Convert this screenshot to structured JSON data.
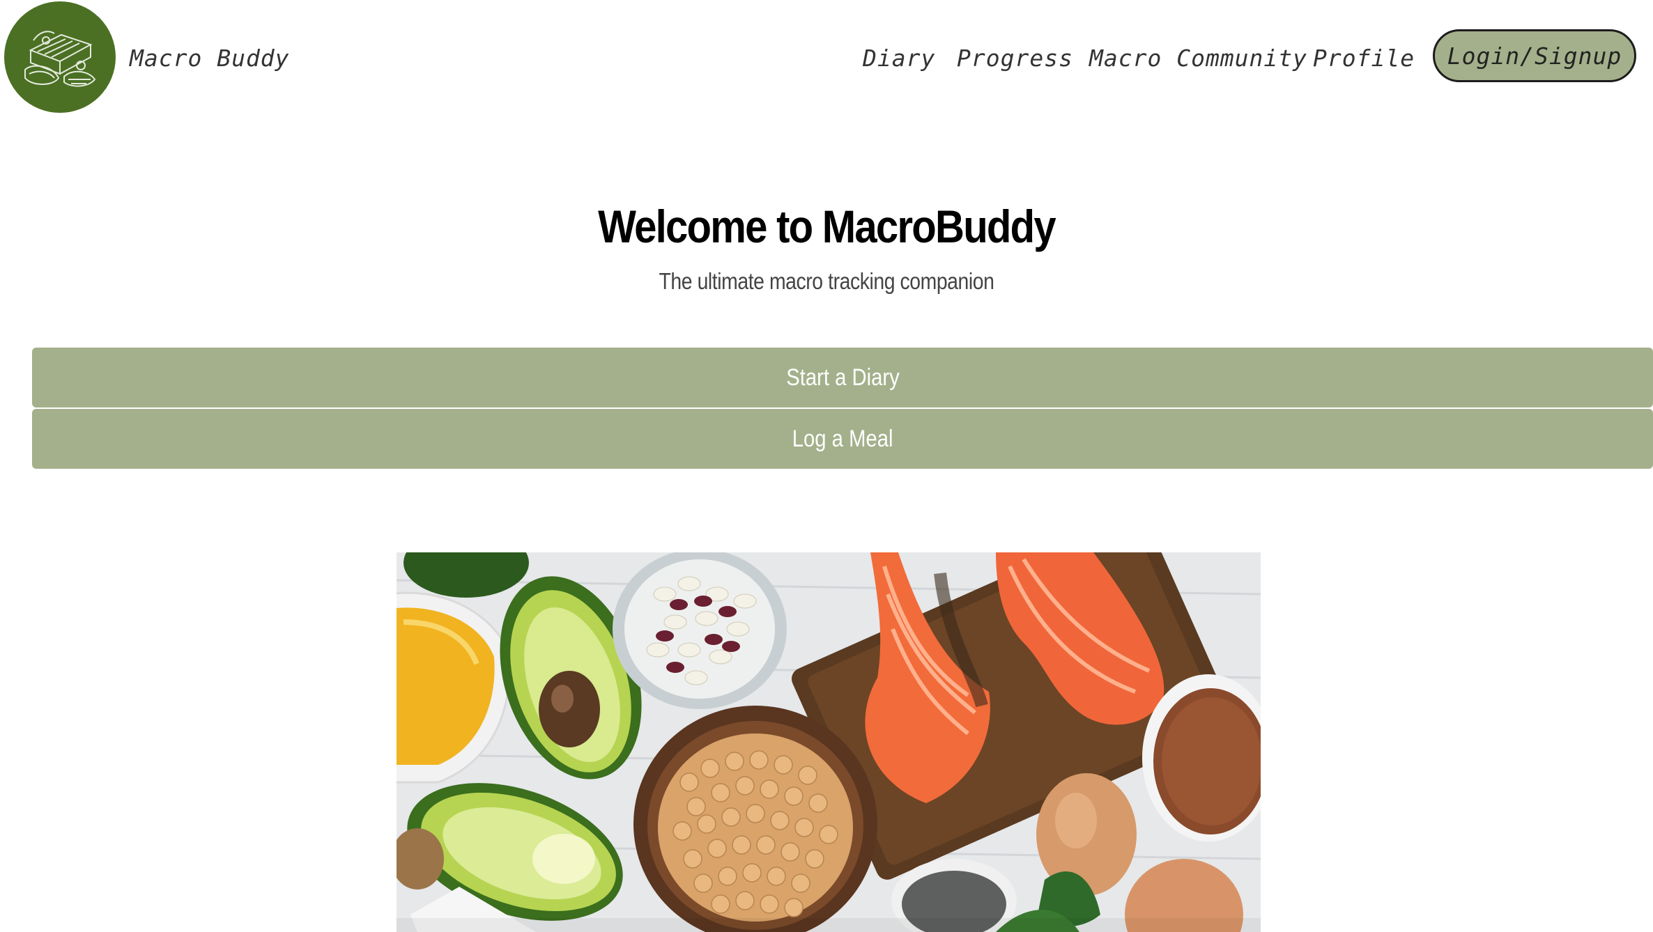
{
  "header": {
    "brand": "Macro Buddy",
    "logo_icon": "food-sketch-icon",
    "nav": [
      {
        "label": "Diary"
      },
      {
        "label": "Progress"
      },
      {
        "label": "Macro Community"
      },
      {
        "label": "Profile"
      }
    ],
    "login_label": "Login/Signup"
  },
  "main": {
    "title": "Welcome to MacroBuddy",
    "subtitle": "The ultimate macro tracking companion",
    "buttons": [
      {
        "label": "Start a Diary"
      },
      {
        "label": "Log a Meal"
      }
    ]
  },
  "hero": {
    "subject": "healthy-foods-photo"
  },
  "colors": {
    "accent": "#a4b08b",
    "logo_bg": "#4b7023",
    "text": "#333333"
  }
}
